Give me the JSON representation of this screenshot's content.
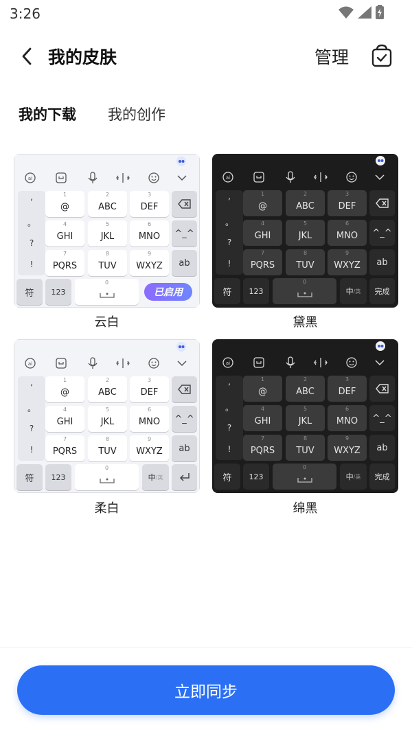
{
  "status": {
    "time": "3:26"
  },
  "header": {
    "title": "我的皮肤",
    "manage_label": "管理"
  },
  "tabs": [
    {
      "label": "我的下载",
      "active": true
    },
    {
      "label": "我的创作",
      "active": false
    }
  ],
  "keyboard": {
    "punct": [
      ",",
      "。",
      "?",
      "!"
    ],
    "row1": [
      {
        "num": "1",
        "label": "@"
      },
      {
        "num": "2",
        "label": "ABC"
      },
      {
        "num": "3",
        "label": "DEF"
      }
    ],
    "row2": [
      {
        "num": "4",
        "label": "GHI"
      },
      {
        "num": "5",
        "label": "JKL"
      },
      {
        "num": "6",
        "label": "MNO"
      }
    ],
    "row3": [
      {
        "num": "7",
        "label": "PQRS"
      },
      {
        "num": "8",
        "label": "TUV"
      },
      {
        "num": "9",
        "label": "WXYZ"
      }
    ],
    "face_key": "^_^",
    "ab_key": "ab",
    "fu_key": "符",
    "num_key": "123",
    "space_num": "0",
    "zh_key": "中",
    "en_mark": "/英",
    "done_key": "完成"
  },
  "skins": [
    {
      "name": "云白",
      "theme": "light",
      "enabled_badge": "已启用"
    },
    {
      "name": "黛黑",
      "theme": "dark"
    },
    {
      "name": "柔白",
      "theme": "light"
    },
    {
      "name": "绵黑",
      "theme": "dark"
    }
  ],
  "sync_button": "立即同步",
  "colors": {
    "accent": "#2b6ff5",
    "badge": "#7b72ff"
  }
}
